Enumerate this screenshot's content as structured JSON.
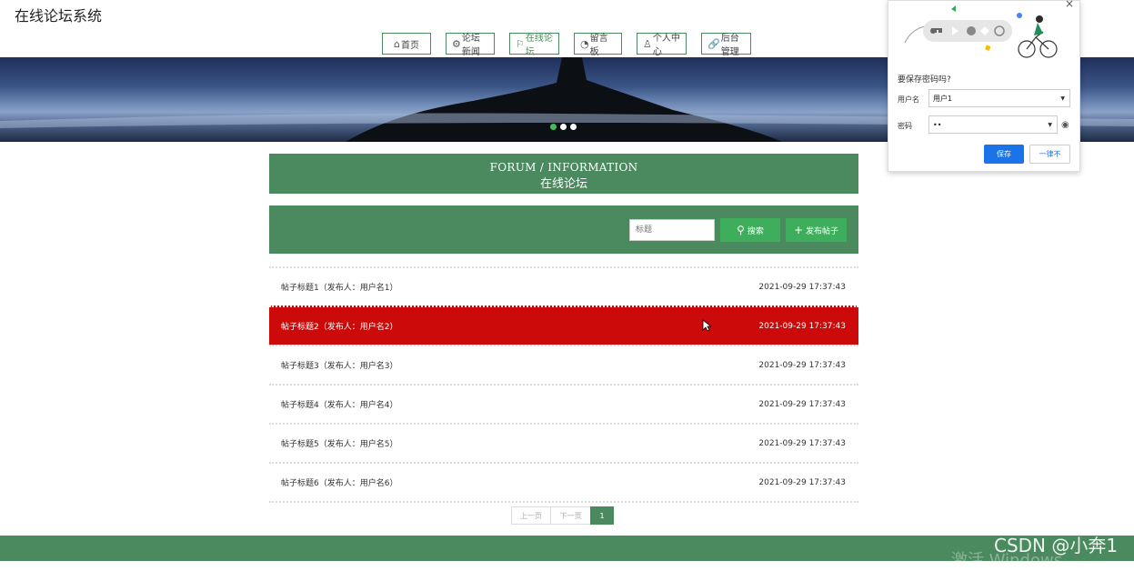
{
  "site": {
    "title": "在线论坛系统"
  },
  "nav": {
    "items": [
      {
        "label": "首页",
        "icon": "home-icon"
      },
      {
        "label": "论坛新闻",
        "icon": "gear-icon"
      },
      {
        "label": "在线论坛",
        "icon": "flag-icon",
        "active": true
      },
      {
        "label": "留言板",
        "icon": "gauge-icon"
      },
      {
        "label": "个人中心",
        "icon": "user-icon"
      },
      {
        "label": "后台管理",
        "icon": "link-icon"
      }
    ]
  },
  "section": {
    "en_title": "FORUM / INFORMATION",
    "cn_title": "在线论坛"
  },
  "search": {
    "placeholder": "标题",
    "search_label": "搜索",
    "post_label": "发布帖子"
  },
  "posts": [
    {
      "title": "帖子标题1（发布人：用户名1）",
      "time": "2021-09-29 17:37:43"
    },
    {
      "title": "帖子标题2（发布人：用户名2）",
      "time": "2021-09-29 17:37:43"
    },
    {
      "title": "帖子标题3（发布人：用户名3）",
      "time": "2021-09-29 17:37:43"
    },
    {
      "title": "帖子标题4（发布人：用户名4）",
      "time": "2021-09-29 17:37:43"
    },
    {
      "title": "帖子标题5（发布人：用户名5）",
      "time": "2021-09-29 17:37:43"
    },
    {
      "title": "帖子标题6（发布人：用户名6）",
      "time": "2021-09-29 17:37:43"
    }
  ],
  "pager": {
    "prev": "上一页",
    "next": "下一页",
    "current": "1"
  },
  "password_prompt": {
    "title": "要保存密码吗?",
    "username_label": "用户名",
    "username_value": "用户1",
    "password_label": "密码",
    "password_value": "••",
    "save_label": "保存",
    "never_label": "一律不"
  },
  "watermark": {
    "text": "CSDN @小奔1",
    "activate": "激活 Windows"
  },
  "colors": {
    "primary": "#4a8a5e",
    "button_green": "#3fae5c",
    "hover_red": "#cc0a0a",
    "chrome_blue": "#1a73e8"
  }
}
